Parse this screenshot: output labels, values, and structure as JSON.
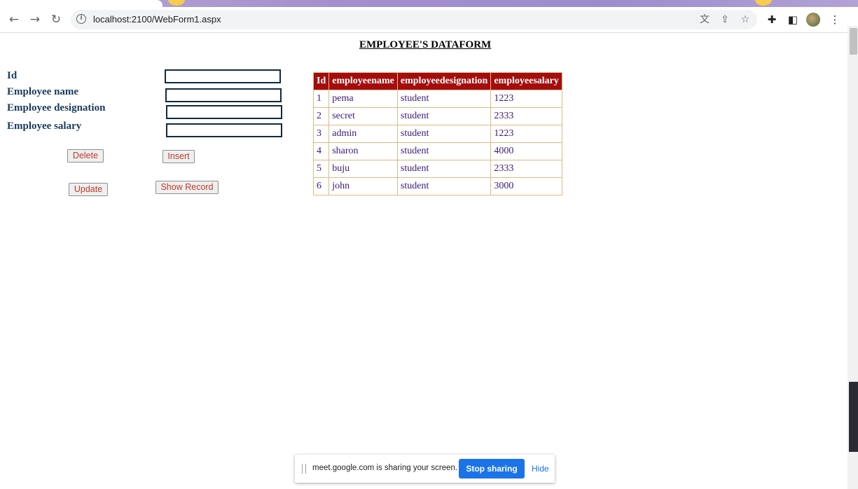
{
  "browser": {
    "url": "localhost:2100/WebForm1.aspx",
    "icons": {
      "back": "arrow-left-icon",
      "forward": "arrow-right-icon",
      "reload": "reload-icon",
      "info": "info-icon",
      "translate": "translate-icon",
      "share": "share-icon",
      "bookmark": "star-icon",
      "extensions": "puzzle-icon",
      "sidepanel": "side-panel-icon",
      "menu": "kebab-menu-icon"
    }
  },
  "form": {
    "title": "EMPLOYEE'S DATAFORM",
    "labels": {
      "id": "Id",
      "name": "Employee name",
      "designation": "Employee designation",
      "salary": "Employee salary"
    },
    "values": {
      "id": "",
      "name": "",
      "designation": "",
      "salary": ""
    },
    "buttons": {
      "delete": "Delete",
      "insert": "Insert",
      "update": "Update",
      "show": "Show Record"
    }
  },
  "grid": {
    "headers": [
      "Id",
      "employeename",
      "employeedesignation",
      "employeesalary"
    ],
    "rows": [
      [
        "1",
        "pema",
        "student",
        "1223"
      ],
      [
        "2",
        "secret",
        "student",
        "2333"
      ],
      [
        "3",
        "admin",
        "student",
        "1223"
      ],
      [
        "4",
        "sharon",
        "student",
        "4000"
      ],
      [
        "5",
        "buju",
        "student",
        "2333"
      ],
      [
        "6",
        "john",
        "student",
        "3000"
      ]
    ],
    "colors": {
      "header_bg": "#a50d0d",
      "header_text": "#ffffff",
      "border": "#deba84",
      "cell_text": "#3a1a7a"
    }
  },
  "meet": {
    "message": "meet.google.com is sharing your screen.",
    "stop": "Stop sharing",
    "hide": "Hide"
  }
}
